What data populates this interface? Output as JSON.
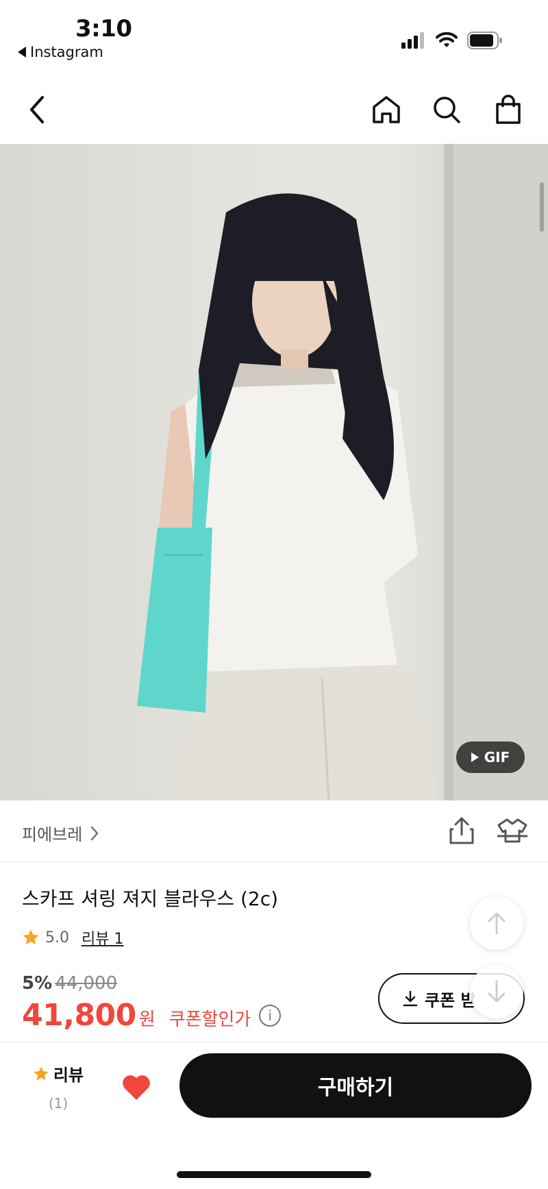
{
  "status_bar": {
    "time": "3:10",
    "back_app": "Instagram",
    "icons": [
      "signal-icon",
      "wifi-icon",
      "battery-icon"
    ]
  },
  "nav": {
    "icons": [
      "back-chevron-icon",
      "home-icon",
      "search-icon",
      "shopping-bag-icon"
    ]
  },
  "hero": {
    "gif_label": "GIF",
    "colors": {
      "bag": "#5fd6cb",
      "hair": "#1c1d26",
      "top": "#f3f2ee",
      "pants": "#e3e1d7"
    }
  },
  "brand": {
    "name": "피에브레",
    "icons": [
      "share-icon",
      "fitting-icon"
    ]
  },
  "product": {
    "title": "스카프 셔링 져지 블라우스 (2c)",
    "rating": "5.0",
    "review_link": "리뷰 1"
  },
  "price": {
    "discount_rate": "5%",
    "original": "44,000",
    "final": "41,800",
    "currency": "원",
    "coupon_note": "쿠폰할인가",
    "info_icon": "i"
  },
  "coupon_button": {
    "label": "쿠폰 받"
  },
  "bottom_bar": {
    "review_label": "리뷰",
    "review_count": "(1)",
    "buy_label": "구매하기"
  },
  "colors": {
    "accent_red": "#f0463c",
    "star": "#f5a623",
    "dark": "#111111"
  }
}
